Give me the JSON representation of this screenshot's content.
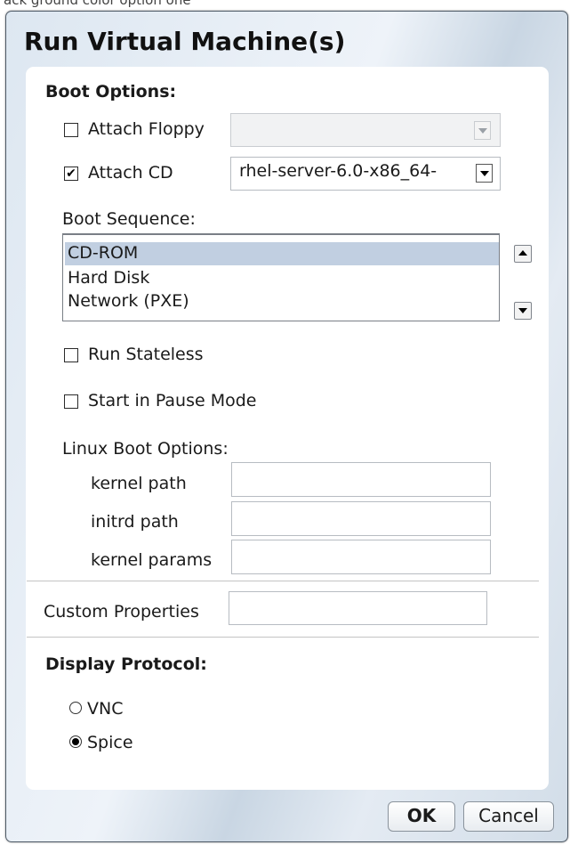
{
  "top_fragment": "ack ground color option one",
  "dialog": {
    "title": "Run Virtual Machine(s)"
  },
  "boot_options": {
    "header": "Boot Options:",
    "attach_floppy": {
      "label": "Attach Floppy",
      "checked": false,
      "value": ""
    },
    "attach_cd": {
      "label": "Attach CD",
      "checked": true,
      "value": "rhel-server-6.0-x86_64- "
    },
    "sequence_label": "Boot Sequence:",
    "sequence_items": [
      "CD-ROM",
      "Hard Disk",
      "Network (PXE)"
    ],
    "selected_index": 0,
    "run_stateless": {
      "label": "Run Stateless",
      "checked": false
    },
    "start_paused": {
      "label": "Start in Pause Mode",
      "checked": false
    },
    "linux_label": "Linux Boot Options:",
    "kernel_path": {
      "label": "kernel path",
      "value": ""
    },
    "initrd_path": {
      "label": "initrd path",
      "value": ""
    },
    "kernel_params": {
      "label": "kernel params",
      "value": ""
    }
  },
  "custom_properties": {
    "label": "Custom Properties",
    "value": ""
  },
  "display_protocol": {
    "header": "Display Protocol:",
    "options": [
      "VNC",
      "Spice"
    ],
    "selected": "Spice"
  },
  "buttons": {
    "ok": "OK",
    "cancel": "Cancel"
  },
  "check_glyph": "✔"
}
